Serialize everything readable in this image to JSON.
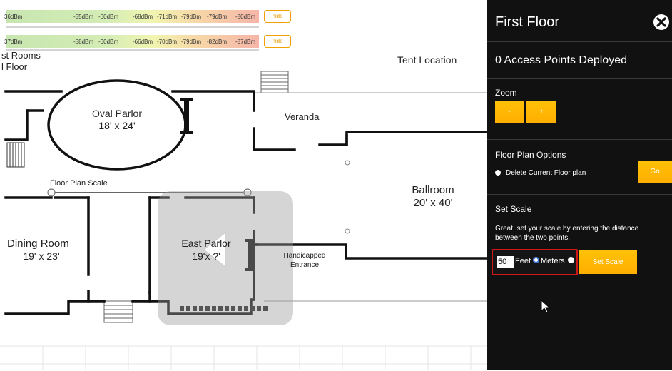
{
  "signal_bars": [
    {
      "first": "36dBm",
      "values": [
        "-55dBm",
        "-60dBm",
        "-68dBm",
        "-71dBm",
        "-79dBm",
        "-79dBm",
        "-80dBm"
      ],
      "hide_label": "hide"
    },
    {
      "first": "37dBm",
      "values": [
        "-58dBm",
        "-60dBm",
        "-66dBm",
        "-70dBm",
        "-79dBm",
        "-82dBm",
        "-87dBm"
      ],
      "hide_label": "hide"
    }
  ],
  "floor_plan": {
    "corner_label_1": "st Rooms",
    "corner_label_2": "l Floor",
    "tent_location": "Tent Location",
    "oval_parlor_name": "Oval Parlor",
    "oval_parlor_size": "18' x 24'",
    "veranda": "Veranda",
    "floor_plan_scale": "Floor Plan Scale",
    "ballroom_name": "Ballroom",
    "ballroom_size": "20' x 40'",
    "dining_room_name": "Dining Room",
    "dining_room_size": "19' x 23'",
    "east_parlor_name": "East Parlor",
    "east_parlor_size": "19'x ?'",
    "handicapped_1": "Handicapped",
    "handicapped_2": "Entrance"
  },
  "panel": {
    "title": "First Floor",
    "close_icon": "close-icon",
    "access_points": "0 Access Points Deployed",
    "zoom_label": "Zoom",
    "zoom_out": "-",
    "zoom_in": "+",
    "options_title": "Floor Plan Options",
    "delete_option": "Delete Current Floor plan",
    "go_label": "Go",
    "scale_title": "Set Scale",
    "scale_help": "Great, set your scale by entering the distance between the two points.",
    "scale_value": "50",
    "feet_label": "Feet",
    "meters_label": "Meters",
    "set_scale_label": "Set Scale"
  },
  "colors": {
    "panel_bg": "#111111",
    "accent": "#ffb400",
    "highlight_border": "#d01818"
  }
}
